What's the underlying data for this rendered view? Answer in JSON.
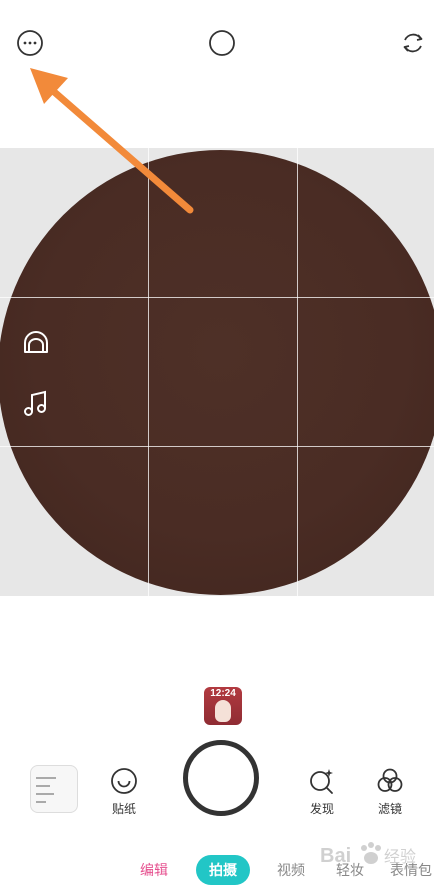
{
  "top_bar": {
    "more_icon": "more-horizontal-icon",
    "circle_icon": "circle-icon",
    "flip_icon": "camera-flip-icon"
  },
  "side_controls": [
    {
      "name": "beauty-icon"
    },
    {
      "name": "music-note-icon"
    }
  ],
  "thumbnail": {
    "time": "12:24"
  },
  "bottom_tools": {
    "sticker_label": "贴纸",
    "discover_label": "发现",
    "filter_label": "滤镜"
  },
  "mode_tabs": {
    "edit": "编辑",
    "shoot": "拍摄",
    "video": "视频",
    "light_makeup": "轻妆",
    "emoji_pack": "表情包"
  },
  "watermark": {
    "text": "Bai经验"
  },
  "colors": {
    "accent_teal": "#22c6c6",
    "pink": "#e6508f",
    "arrow_orange": "#f28a3a",
    "viewfinder_brown": "#4a2c24"
  }
}
